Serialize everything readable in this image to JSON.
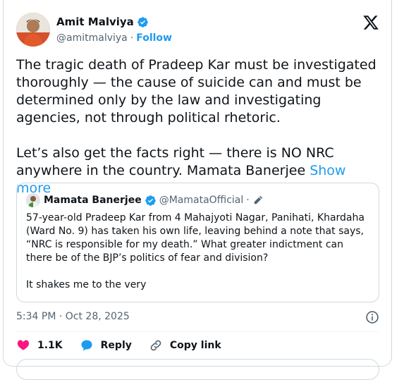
{
  "author": {
    "name": "Amit Malviya",
    "handle": "@amitmalviya",
    "separator": "·",
    "follow_label": "Follow"
  },
  "tweet": {
    "paragraph1": "The tragic death of Pradeep Kar must be investigated thoroughly — the cause of suicide can and must be determined only by the law and investigating agencies, not through political rhetoric.",
    "paragraph2": "Let’s also get the facts right — there is NO NRC anywhere in the country. Mamata Banerjee ",
    "show_more": "Show more"
  },
  "quote": {
    "name": "Mamata Banerjee",
    "handle": "@MamataOfficial",
    "separator": "·",
    "paragraph1": "57-year-old Pradeep Kar from 4 Mahajyoti Nagar, Panihati, Khardaha (Ward No. 9) has taken his own life, leaving behind a note that says, “NRC is responsible for my death.” What greater indictment can there be of the BJP’s politics of fear and division?",
    "paragraph2": "It shakes me to the very"
  },
  "meta": {
    "timestamp": "5:34 PM · Oct 28, 2025"
  },
  "actions": {
    "likes": "1.1K",
    "reply_label": "Reply",
    "copy_link_label": "Copy link"
  },
  "colors": {
    "accent": "#1d9bf0",
    "like": "#f91880",
    "muted": "#536471",
    "text": "#0f1419"
  },
  "icons": {
    "verified": "verified-badge-icon",
    "x_logo": "x-logo-icon",
    "info": "info-icon",
    "like": "heart-icon",
    "reply": "reply-bubble-icon",
    "copy_link": "link-icon",
    "edit": "edit-pencil-icon"
  }
}
